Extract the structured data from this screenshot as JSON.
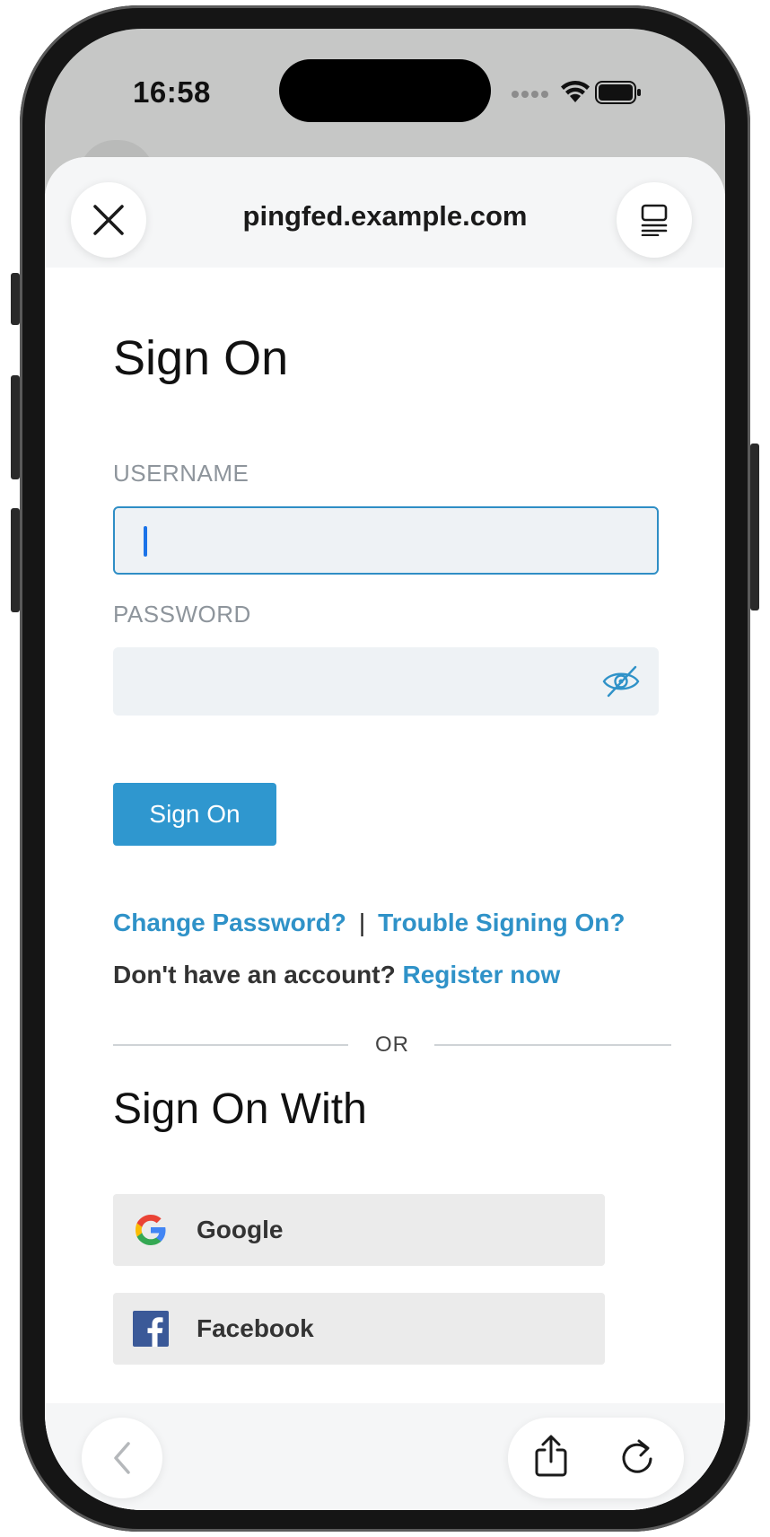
{
  "status_bar": {
    "time": "16:58"
  },
  "browser": {
    "url": "pingfed.example.com",
    "close_icon": "close-icon",
    "reader_icon": "reader-mode-icon"
  },
  "form": {
    "title": "Sign On",
    "username_label": "USERNAME",
    "username_value": "",
    "password_label": "PASSWORD",
    "password_value": "",
    "submit_label": "Sign On",
    "change_password_link": "Change Password?",
    "separator": "|",
    "trouble_link": "Trouble Signing On?",
    "no_account_text": "Don't have an account?",
    "register_link": "Register now",
    "or_text": "OR"
  },
  "social": {
    "title": "Sign On With",
    "providers": [
      {
        "label": "Google",
        "icon": "google-icon"
      },
      {
        "label": "Facebook",
        "icon": "facebook-icon"
      }
    ]
  },
  "colors": {
    "accent": "#2f97cf",
    "link": "#2f92c8",
    "facebook": "#3b5998"
  }
}
